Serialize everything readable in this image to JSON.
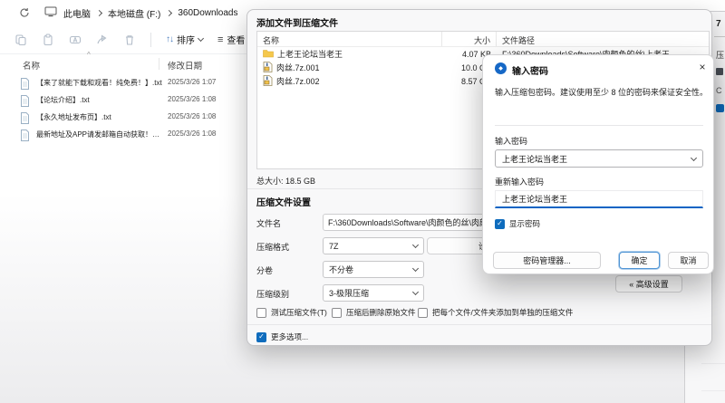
{
  "explorer": {
    "breadcrumb": {
      "items": [
        "此电脑",
        "本地磁盘 (F:)",
        "360Downloads"
      ]
    },
    "toolbar": {
      "sort_label": "排序",
      "view_label": "查看",
      "sort_glyph": "↑↓",
      "view_glyph": "≡"
    },
    "columns": {
      "name": "名称",
      "date": "修改日期",
      "sort_indicator": "^"
    },
    "files": [
      {
        "name": "【来了就能下载和观看！纯免费！】.txt",
        "date": "2025/3/26 1:07"
      },
      {
        "name": "【论坛介绍】.txt",
        "date": "2025/3/26 1:08"
      },
      {
        "name": "【永久地址发布页】.txt",
        "date": "2025/3/26 1:08"
      },
      {
        "name": "最新地址及APP请发邮箱自动获取！！！...",
        "date": "2025/3/26 1:08"
      }
    ]
  },
  "archive_dialog": {
    "title": "添加文件到压缩文件",
    "columns": {
      "name": "名称",
      "size": "大小",
      "path": "文件路径"
    },
    "items": [
      {
        "name": "上老王论坛当老王",
        "size": "4.07 KB",
        "path": "F:\\360Downloads\\Software\\肉颜色的丝\\上老王..."
      },
      {
        "name": "肉丝.7z.001",
        "size": "10.0 GB",
        "path": ""
      },
      {
        "name": "肉丝.7z.002",
        "size": "8.57 GB",
        "path": ""
      }
    ],
    "total_size": "总大小: 18.5 GB",
    "settings_title": "压缩文件设置",
    "filename_label": "文件名",
    "filename_value": "F:\\360Downloads\\Software\\肉颜色的丝\\肉颜",
    "format_label": "压缩格式",
    "format_value": "7Z",
    "set_password_label": "设置密码",
    "split_label": "分卷",
    "split_value": "不分卷",
    "level_label": "压缩级别",
    "level_value": "3-极限压缩",
    "checkboxes": [
      {
        "label": "测试压缩文件(T)",
        "checked": false
      },
      {
        "label": "压缩后删除原始文件",
        "checked": false
      },
      {
        "label": "把每个文件/文件夹添加到单独的压缩文件",
        "checked": false
      }
    ],
    "more_options_label": "更多选项...",
    "advanced_button": "« 高级设置",
    "check_glyph": "✓"
  },
  "password_dialog": {
    "title": "输入密码",
    "subtitle": "输入压缩包密码。建议使用至少 8 位的密码来保证安全性。",
    "close_glyph": "×",
    "icon_glyph": "◆",
    "password_label": "输入密码",
    "password_value": "上老王论坛当老王",
    "confirm_label": "重新输入密码",
    "confirm_value": "上老王论坛当老王",
    "show_password_label": "显示密码",
    "buttons": {
      "manager": "密码管理器...",
      "ok": "确定",
      "cancel": "取消"
    },
    "check_glyph": "✓"
  },
  "side_window": {
    "glyph_top": "7",
    "glyph_1": "压",
    "glyph_2": "C"
  },
  "colors": {
    "accent": "#0f6cbd",
    "focus_border": "#0b64c4",
    "folder": "#f5c84c"
  }
}
